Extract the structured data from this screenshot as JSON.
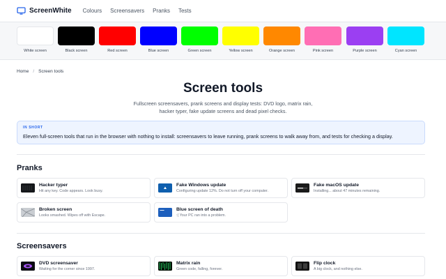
{
  "app": {
    "name": "ScreenWhite"
  },
  "nav": [
    "Colours",
    "Screensavers",
    "Pranks",
    "Tests"
  ],
  "swatches": [
    {
      "label": "White screen",
      "color": "#ffffff"
    },
    {
      "label": "Black screen",
      "color": "#000000"
    },
    {
      "label": "Red screen",
      "color": "#ff0000"
    },
    {
      "label": "Blue screen",
      "color": "#0000ff"
    },
    {
      "label": "Green screen",
      "color": "#00ff00"
    },
    {
      "label": "Yellow screen",
      "color": "#ffff00"
    },
    {
      "label": "Orange screen",
      "color": "#ff8800"
    },
    {
      "label": "Pink screen",
      "color": "#ff6eb4"
    },
    {
      "label": "Purple screen",
      "color": "#9b3ff2"
    },
    {
      "label": "Cyan screen",
      "color": "#00e5ff"
    }
  ],
  "breadcrumb": [
    "Home",
    "Screen tools"
  ],
  "page": {
    "title": "Screen tools",
    "subtitle": "Fullscreen screensavers, prank screens and display tests: DVD logo, matrix rain, hacker typer, fake update screens and dead pixel checks."
  },
  "info": {
    "label": "IN SHORT",
    "text": "Eleven full-screen tools that run in the browser with nothing to install: screensavers to leave running, prank screens to walk away from, and tests for checking a display."
  },
  "sections": {
    "pranks": {
      "title": "Pranks",
      "cards": [
        {
          "title": "Hacker typer",
          "desc": "Hit any key. Code appears. Look busy."
        },
        {
          "title": "Fake Windows update",
          "desc": "Configuring update 12%. Do not turn off your computer."
        },
        {
          "title": "Fake macOS update",
          "desc": "Installing... about 47 minutes remaining."
        },
        {
          "title": "Broken screen",
          "desc": "Looks smashed. Wipes off with Escape."
        },
        {
          "title": "Blue screen of death",
          "desc": ":( Your PC ran into a problem."
        }
      ]
    },
    "screensavers": {
      "title": "Screensavers",
      "cards": [
        {
          "title": "DVD screensaver",
          "desc": "Waiting for the corner since 1997."
        },
        {
          "title": "Matrix rain",
          "desc": "Green code, falling, forever."
        },
        {
          "title": "Flip clock",
          "desc": "A big clock, and nothing else."
        }
      ]
    }
  },
  "colors": {
    "accent": "#2563eb",
    "info_bg": "#eef4ff"
  },
  "icons": {
    "logo": "monitor-icon",
    "thumbs": [
      "hacker-terminal-icon",
      "windows-update-icon",
      "macos-update-icon",
      "broken-screen-icon",
      "bsod-icon",
      "dvd-logo-icon",
      "matrix-rain-icon",
      "flip-clock-icon"
    ]
  }
}
